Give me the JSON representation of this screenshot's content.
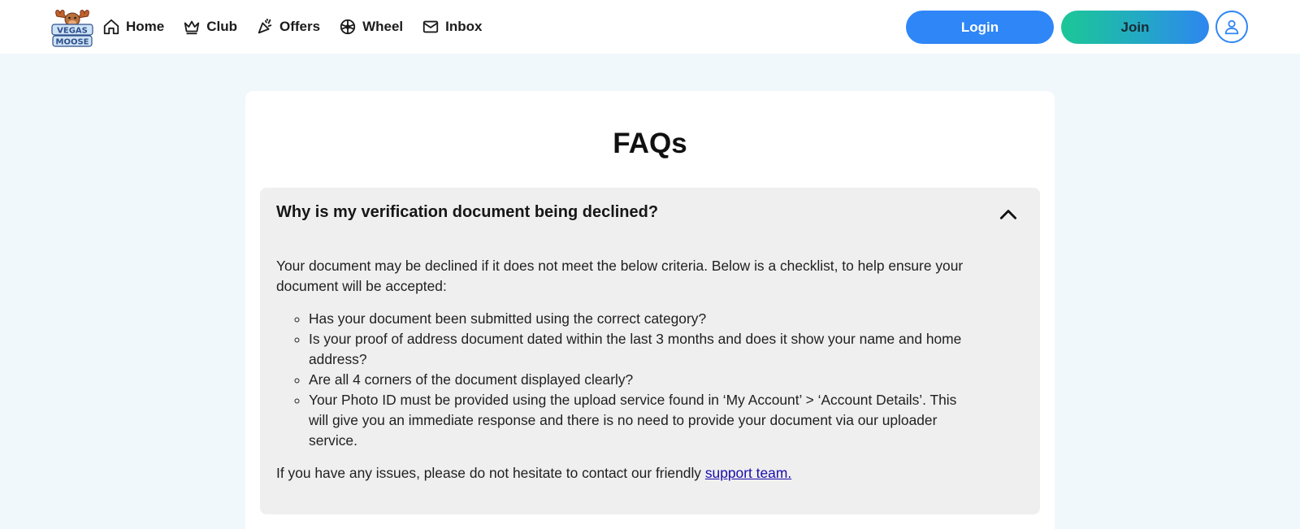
{
  "brand": {
    "logo_line1": "VEGAS",
    "logo_line2": "MOOSE"
  },
  "nav": [
    {
      "label": "Home",
      "icon": "home-icon"
    },
    {
      "label": "Club",
      "icon": "crown-icon"
    },
    {
      "label": "Offers",
      "icon": "party-popper-icon"
    },
    {
      "label": "Wheel",
      "icon": "wheel-icon"
    },
    {
      "label": "Inbox",
      "icon": "mail-icon"
    }
  ],
  "auth": {
    "login_label": "Login",
    "join_label": "Join"
  },
  "colors": {
    "accent": "#2f86f7",
    "join_start": "#1cc796",
    "faq_bg": "#efefef",
    "page_bg": "#f1f8fb"
  },
  "page": {
    "title": "FAQs"
  },
  "faq": {
    "question": "Why is my verification document being declined?",
    "intro": "Your document may be declined if it does not meet the below criteria. Below is a checklist, to help ensure your document will be accepted:",
    "items": [
      "Has your document been submitted using the correct category?",
      "Is your proof of address document dated within the last 3 months and does it show your name and home address?",
      "Are all 4 corners of the document displayed clearly?",
      "Your Photo ID must be provided using the upload service found in ‘My Account’ > ‘Account Details’. This will give you an immediate response and there is no need to provide your document via our uploader service."
    ],
    "outro": "If you have any issues, please do not hesitate to contact our friendly ",
    "link_label": "support team."
  }
}
